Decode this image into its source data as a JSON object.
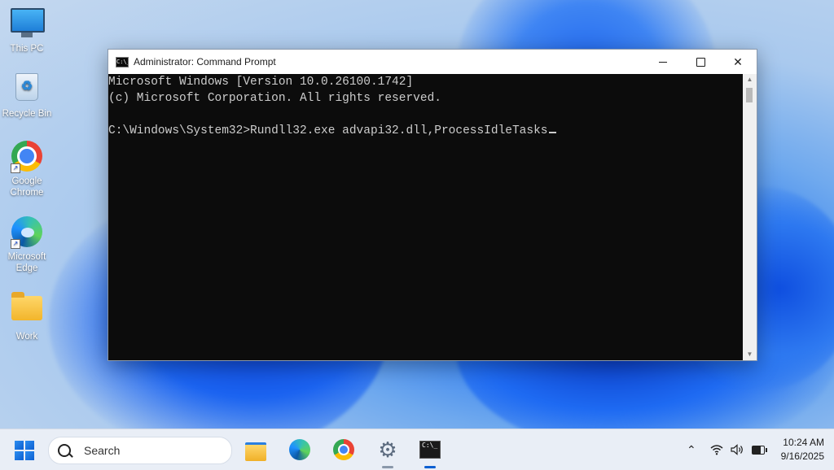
{
  "desktop": {
    "icons": [
      {
        "label": "This PC",
        "icon": "monitor-icon"
      },
      {
        "label": "Recycle Bin",
        "icon": "recycle-bin-icon"
      },
      {
        "label": "Google Chrome",
        "icon": "chrome-icon"
      },
      {
        "label": "Microsoft Edge",
        "icon": "edge-icon"
      },
      {
        "label": "Work",
        "icon": "folder-icon"
      }
    ]
  },
  "window": {
    "title": "Administrator: Command Prompt",
    "console_lines": [
      "Microsoft Windows [Version 10.0.26100.1742]",
      "(c) Microsoft Corporation. All rights reserved.",
      "",
      "C:\\Windows\\System32>Rundll32.exe advapi32.dll,ProcessIdleTasks"
    ],
    "controls": {
      "minimize": "minimize",
      "maximize": "maximize",
      "close": "close"
    }
  },
  "taskbar": {
    "search_placeholder": "Search",
    "apps": [
      "File Explorer",
      "Microsoft Edge",
      "Google Chrome",
      "Settings",
      "Command Prompt"
    ],
    "clock_time": "10:24 AM",
    "clock_date": "9/16/2025"
  },
  "colors": {
    "console_bg": "#0c0c0c",
    "console_fg": "#cccccc",
    "accent": "#0c5fd1"
  }
}
